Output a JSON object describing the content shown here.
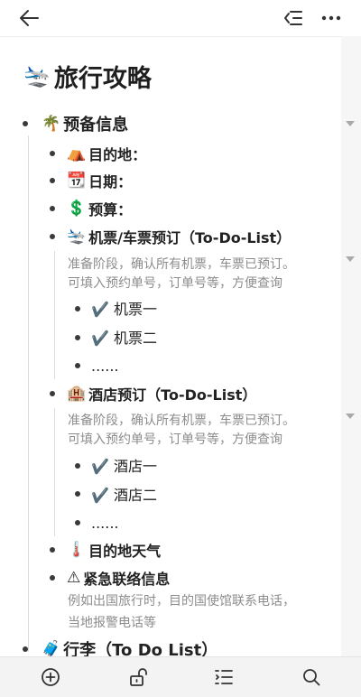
{
  "header": {
    "back_icon": "arrow-left-icon",
    "outline_icon": "outline-list-icon",
    "more_icon": "more-dots-icon"
  },
  "document": {
    "title_emoji": "🛬",
    "title": "旅行攻略",
    "sections": [
      {
        "emoji": "🌴",
        "label": "预备信息",
        "children": [
          {
            "emoji": "⛺",
            "label": "目的地："
          },
          {
            "emoji": "📆",
            "label": "日期："
          },
          {
            "emoji": "💲",
            "label": "预算："
          },
          {
            "emoji": "🛬",
            "label": "机票/车票预订（To-Do-List）",
            "note": [
              "准备阶段，确认所有机票，车票已预订。",
              "可填入预约单号，订单号等，方便查询"
            ],
            "items": [
              "✔️ 机票一",
              "✔️ 机票二",
              "......"
            ]
          },
          {
            "emoji": "🏨",
            "label": "酒店预订（To-Do-List）",
            "note": [
              "准备阶段，确认所有机票，车票已预订。",
              "可填入预约单号，订单号等，方便查询"
            ],
            "items": [
              "✔️ 酒店一",
              "✔️ 酒店二",
              "......"
            ]
          },
          {
            "emoji": "🌡️",
            "label": "目的地天气"
          },
          {
            "emoji": "⚠",
            "label": "紧急联络信息",
            "note": [
              "例如出国旅行时，目的国使馆联系电话，",
              "当地报警电话等"
            ]
          }
        ]
      },
      {
        "emoji": "🧳",
        "label": "行李（To Do List）"
      }
    ]
  },
  "toolbar": {
    "add_icon": "add-circle-icon",
    "lock_icon": "unlock-icon",
    "format_icon": "list-format-icon",
    "search_icon": "search-icon"
  }
}
